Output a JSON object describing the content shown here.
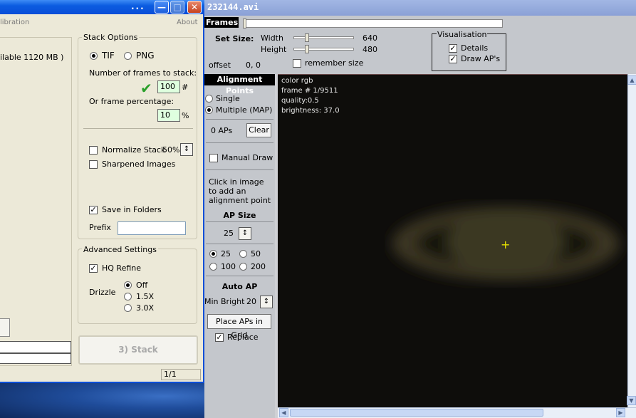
{
  "left_window": {
    "title_dots": "...",
    "menu_left": "libration",
    "menu_right": "About",
    "available_text": "ilable 1120 MB )",
    "stack_options": {
      "title": "Stack Options",
      "format_tif": "TIF",
      "format_png": "PNG",
      "selected_format": "TIF",
      "frames_label": "Number of frames to stack:",
      "frames_value": "100",
      "frames_unit": "#",
      "percentage_label": "Or frame percentage:",
      "percentage_value": "10",
      "percentage_unit": "%",
      "normalize_label": "Normalize Stack",
      "normalize_checked": false,
      "normalize_value": "50%",
      "sharpened_label": "Sharpened Images",
      "sharpened_checked": false,
      "save_folders_label": "Save in Folders",
      "save_folders_checked": true,
      "prefix_label": "Prefix",
      "prefix_value": ""
    },
    "advanced": {
      "title": "Advanced Settings",
      "hq_refine_label": "HQ Refine",
      "hq_refine_checked": true,
      "drizzle_label": "Drizzle",
      "drizzle_options": [
        "Off",
        "1.5X",
        "3.0X"
      ],
      "drizzle_selected": "Off"
    },
    "stack_button": "3) Stack",
    "status_page": "1/1"
  },
  "right_window": {
    "title": "232144.avi",
    "frames_tab": "Frames",
    "set_size_label": "Set Size:",
    "width_label": "Width",
    "width_value": "640",
    "height_label": "Height",
    "height_value": "480",
    "offset_label": "offset",
    "offset_value": "0, 0",
    "remember_size_label": "remember size",
    "remember_size_checked": false,
    "visualisation": {
      "title": "Visualisation",
      "details_label": "Details",
      "details_checked": true,
      "draw_aps_label": "Draw AP's",
      "draw_aps_checked": true
    },
    "alignment": {
      "header": "Alignment Points",
      "single_label": "Single",
      "multiple_label": "Multiple (MAP)",
      "mode_selected": "Multiple (MAP)",
      "ap_count": "0 APs",
      "clear_button": "Clear",
      "manual_draw_label": "Manual Draw",
      "manual_draw_checked": false,
      "hint_line1": "Click in image",
      "hint_line2": "to add an",
      "hint_line3": "alignment point",
      "ap_size_header": "AP Size",
      "ap_size_value": "25",
      "ap_size_options": [
        "25",
        "50",
        "100",
        "200"
      ],
      "ap_size_selected": "25",
      "auto_ap_header": "Auto AP",
      "min_bright_label": "Min Bright",
      "min_bright_value": "20",
      "place_grid_button": "Place APs in Grid",
      "replace_label": "Replace",
      "replace_checked": true
    },
    "image_info": {
      "color": "color rgb",
      "frame": "frame # 1/9511",
      "quality": "quality:0.5",
      "brightness": "brightness: 37.0"
    }
  },
  "colors": {
    "xp_title_blue": "#0a4ed8",
    "dialog_bg": "#ece9d8",
    "toolbar_bg": "#c4c7cc",
    "numeric_field_bg": "#dfffdf",
    "crosshair": "#e4e000",
    "check_green": "#2aa02a"
  },
  "icons": [
    "checkmark-icon",
    "spin-updown-icon",
    "scroll-left-icon",
    "scroll-right-icon",
    "scroll-up-icon",
    "scroll-down-icon",
    "crosshair-icon"
  ]
}
